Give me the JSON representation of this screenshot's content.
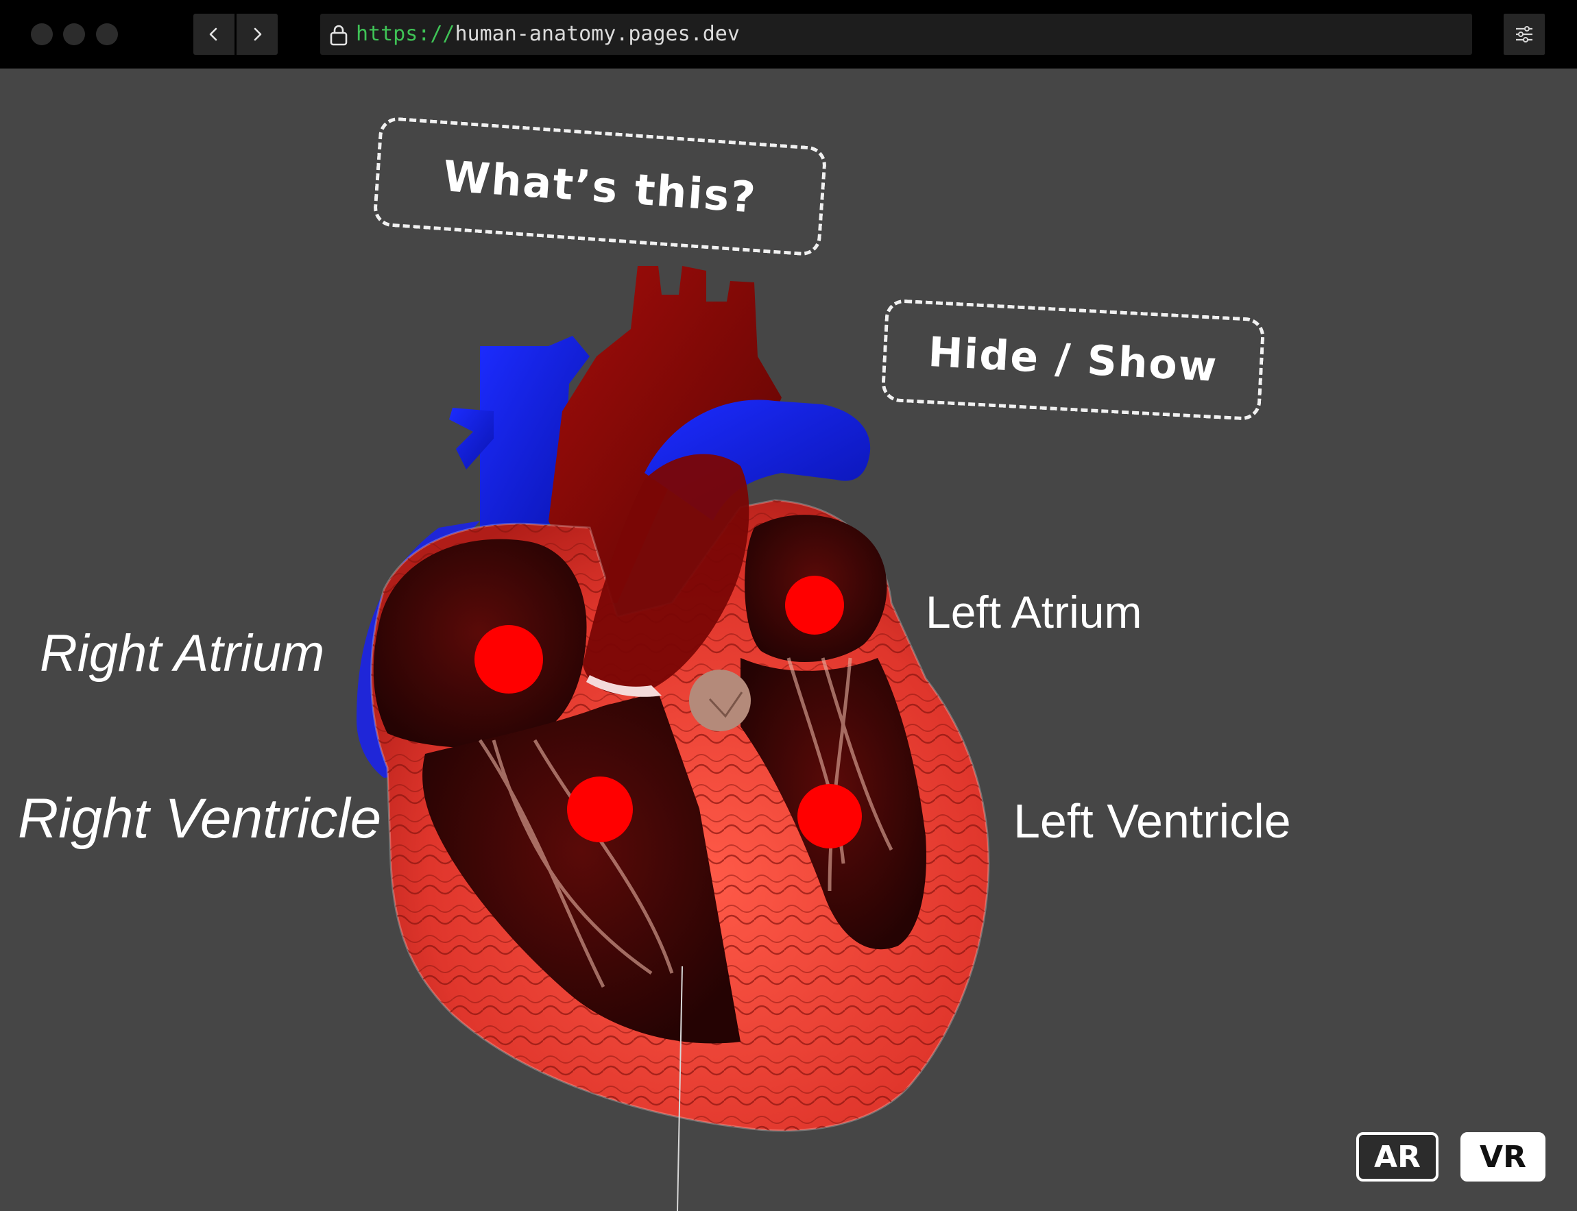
{
  "browser": {
    "url_scheme": "https://",
    "url_host": "human-anatomy.pages.dev",
    "back_icon": "chevron-left-icon",
    "forward_icon": "chevron-right-icon",
    "menu_icon": "sliders-icon",
    "lock_icon": "lock-icon"
  },
  "scene": {
    "whats_this_label": "What’s this?",
    "hide_show_label": "Hide / Show",
    "labels": {
      "right_atrium": "Right Atrium",
      "right_ventricle": "Right Ventricle",
      "left_atrium": "Left Atrium",
      "left_ventricle": "Left Ventricle"
    },
    "ar_label": "AR",
    "vr_label": "VR"
  },
  "colors": {
    "scene_background": "#464646",
    "hotspot": "#ff0000",
    "url_scheme": "#3fc356",
    "oxygenated_vessel": "#8b0000",
    "deoxygenated_vessel": "#0a1ee0",
    "myocardium": "#e0362c"
  }
}
